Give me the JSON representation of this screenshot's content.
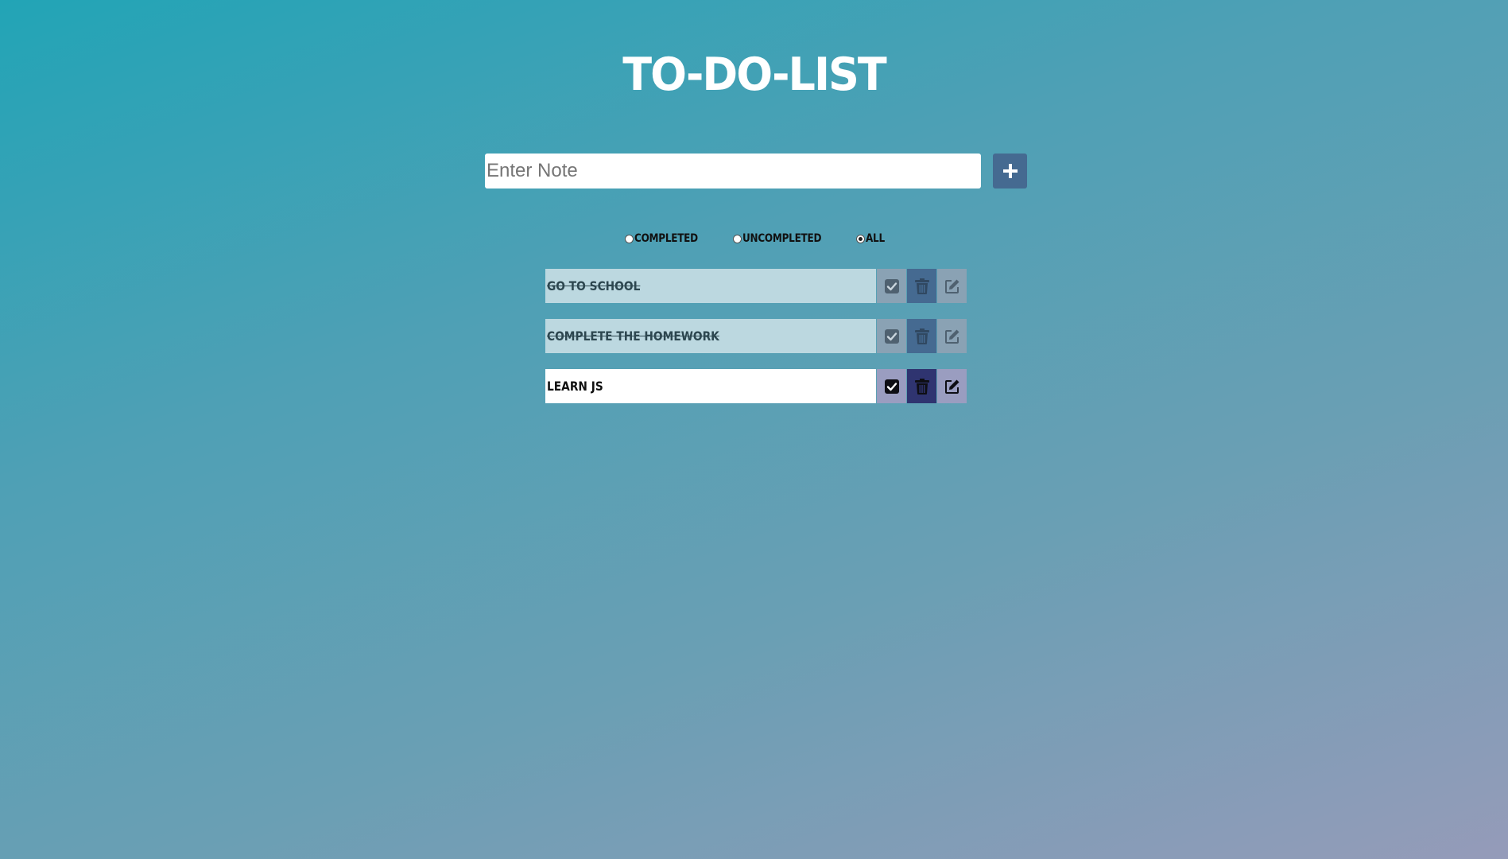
{
  "app": {
    "title": "TO-DO-LIST"
  },
  "input": {
    "placeholder": "Enter Note",
    "value": ""
  },
  "add_button": {
    "icon": "plus-icon"
  },
  "filters": [
    {
      "label": "COMPLETED",
      "selected": false
    },
    {
      "label": "UNCOMPLETED",
      "selected": false
    },
    {
      "label": "ALL",
      "selected": true
    }
  ],
  "todos": [
    {
      "text": "GO TO SCHOOL",
      "completed": true
    },
    {
      "text": "COMPLETE THE HOMEWORK",
      "completed": true
    },
    {
      "text": "LEARN JS",
      "completed": false
    }
  ],
  "icons": {
    "complete": "check-square-icon",
    "delete": "trash-icon",
    "edit": "edit-icon"
  },
  "colors": {
    "add_button": "#456a91",
    "completed_row": "#bcd8e0",
    "active_row": "#ffffff",
    "active_delete": "#2f3470",
    "active_side_buttons": "#9a9dc0"
  }
}
